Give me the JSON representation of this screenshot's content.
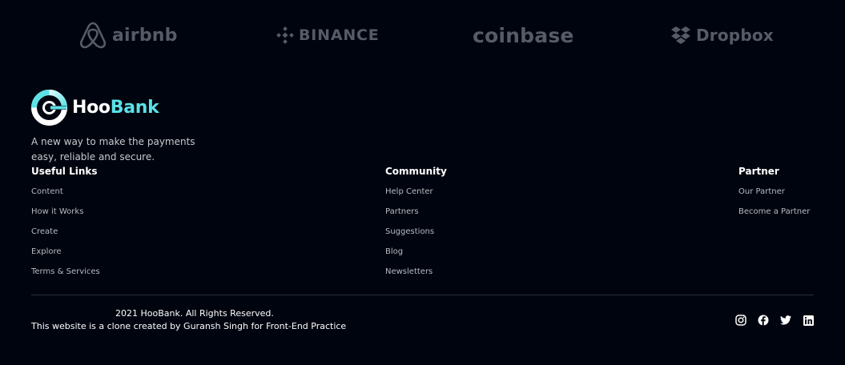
{
  "clients": [
    {
      "name": "airbnb",
      "icon": "airbnb-logo-icon"
    },
    {
      "name": "BINANCE",
      "icon": "binance-logo-icon"
    },
    {
      "name": "coinbase",
      "icon": "coinbase-logo-icon"
    },
    {
      "name": "Dropbox",
      "icon": "dropbox-logo-icon"
    }
  ],
  "brand": {
    "name_part1": "Hoo",
    "name_part2": "Bank",
    "icon": "hoobank-logo-icon",
    "tagline_line1": "A new way to make the payments",
    "tagline_line2": "easy, reliable and secure.",
    "accent_color": "#5ce1e6"
  },
  "footer_links": [
    {
      "title": "Useful Links",
      "links": [
        "Content",
        "How it Works",
        "Create",
        "Explore",
        "Terms & Services"
      ]
    },
    {
      "title": "Community",
      "links": [
        "Help Center",
        "Partners",
        "Suggestions",
        "Blog",
        "Newsletters"
      ]
    },
    {
      "title": "Partner",
      "links": [
        "Our Partner",
        "Become a Partner"
      ]
    }
  ],
  "copyright": {
    "line1": "2021 HooBank. All Rights Reserved.",
    "line2": "This website is a clone created by Guransh Singh for Front-End Practice"
  },
  "socials": [
    {
      "name": "instagram",
      "icon": "instagram-icon"
    },
    {
      "name": "facebook",
      "icon": "facebook-icon"
    },
    {
      "name": "twitter",
      "icon": "twitter-icon"
    },
    {
      "name": "linkedin",
      "icon": "linkedin-icon"
    }
  ],
  "colors": {
    "background": "#00040f",
    "logo_gray": "#565b67",
    "divider": "#2b2e36"
  }
}
